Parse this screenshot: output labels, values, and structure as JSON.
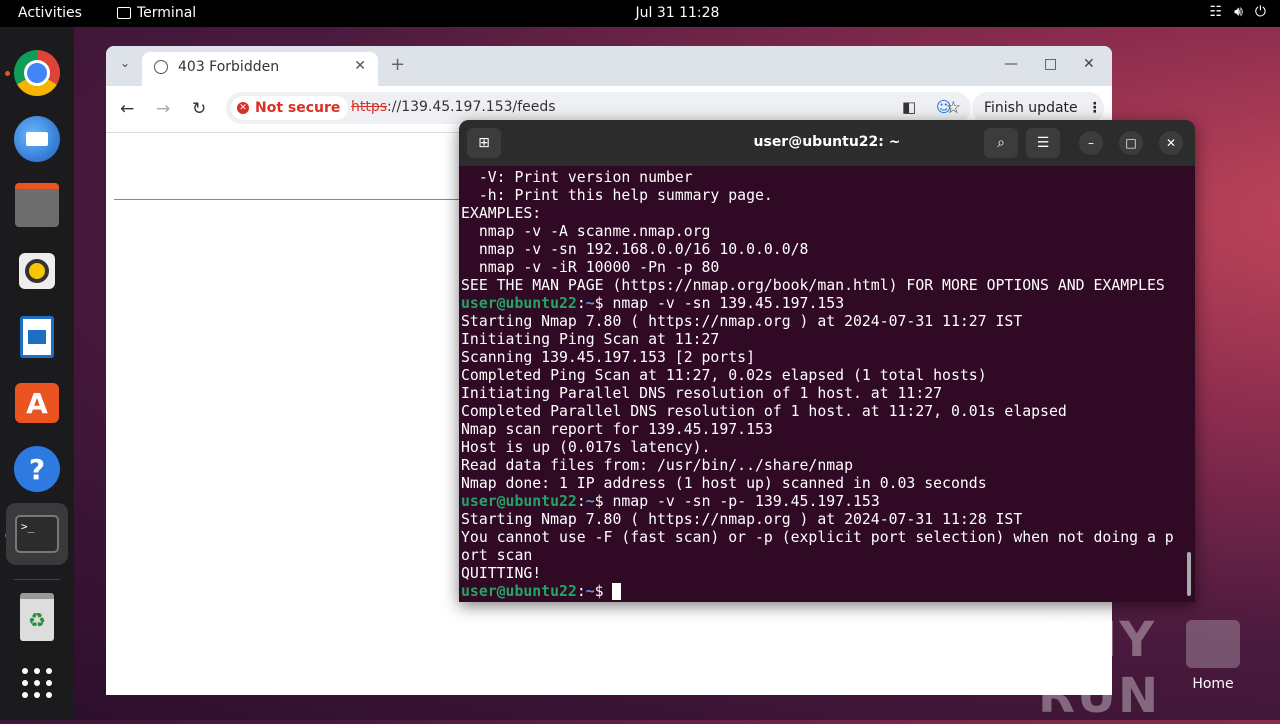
{
  "topbar": {
    "activities": "Activities",
    "app_name": "Terminal",
    "clock": "Jul 31  11:28"
  },
  "dock": {
    "items": [
      {
        "name": "chrome",
        "active": true
      },
      {
        "name": "thunderbird"
      },
      {
        "name": "files"
      },
      {
        "name": "rhythmbox"
      },
      {
        "name": "libreoffice-writer"
      },
      {
        "name": "app-center"
      },
      {
        "name": "help"
      },
      {
        "name": "terminal",
        "active": true
      },
      {
        "name": "trash"
      },
      {
        "name": "show-apps"
      }
    ]
  },
  "browser": {
    "tab_title": "403 Forbidden",
    "not_secure": "Not secure",
    "url_scheme": "https",
    "url_rest": "://139.45.197.153/feeds",
    "finish_update": "Finish update"
  },
  "terminal": {
    "title": "user@ubuntu22: ~",
    "prompt_user": "user@ubuntu22",
    "prompt_path": "~",
    "lines": [
      {
        "text": "  -V: Print version number"
      },
      {
        "text": "  -h: Print this help summary page."
      },
      {
        "text": "EXAMPLES:"
      },
      {
        "text": "  nmap -v -A scanme.nmap.org"
      },
      {
        "text": "  nmap -v -sn 192.168.0.0/16 10.0.0.0/8"
      },
      {
        "text": "  nmap -v -iR 10000 -Pn -p 80"
      },
      {
        "text": "SEE THE MAN PAGE (https://nmap.org/book/man.html) FOR MORE OPTIONS AND EXAMPLES"
      },
      {
        "prompt": true,
        "cmd": "nmap -v -sn 139.45.197.153"
      },
      {
        "text": "Starting Nmap 7.80 ( https://nmap.org ) at 2024-07-31 11:27 IST"
      },
      {
        "text": "Initiating Ping Scan at 11:27"
      },
      {
        "text": "Scanning 139.45.197.153 [2 ports]"
      },
      {
        "text": "Completed Ping Scan at 11:27, 0.02s elapsed (1 total hosts)"
      },
      {
        "text": "Initiating Parallel DNS resolution of 1 host. at 11:27"
      },
      {
        "text": "Completed Parallel DNS resolution of 1 host. at 11:27, 0.01s elapsed"
      },
      {
        "text": "Nmap scan report for 139.45.197.153"
      },
      {
        "text": "Host is up (0.017s latency)."
      },
      {
        "text": "Read data files from: /usr/bin/../share/nmap"
      },
      {
        "text": "Nmap done: 1 IP address (1 host up) scanned in 0.03 seconds"
      },
      {
        "prompt": true,
        "cmd": "nmap -v -sn -p- 139.45.197.153"
      },
      {
        "text": "Starting Nmap 7.80 ( https://nmap.org ) at 2024-07-31 11:28 IST"
      },
      {
        "text": "You cannot use -F (fast scan) or -p (explicit port selection) when not doing a p"
      },
      {
        "text": "ort scan"
      },
      {
        "text": "QUITTING!"
      },
      {
        "prompt": true,
        "cmd": "",
        "cursor": true
      }
    ]
  },
  "desktop": {
    "watermark": "ANY RUN",
    "home_label": "Home"
  }
}
